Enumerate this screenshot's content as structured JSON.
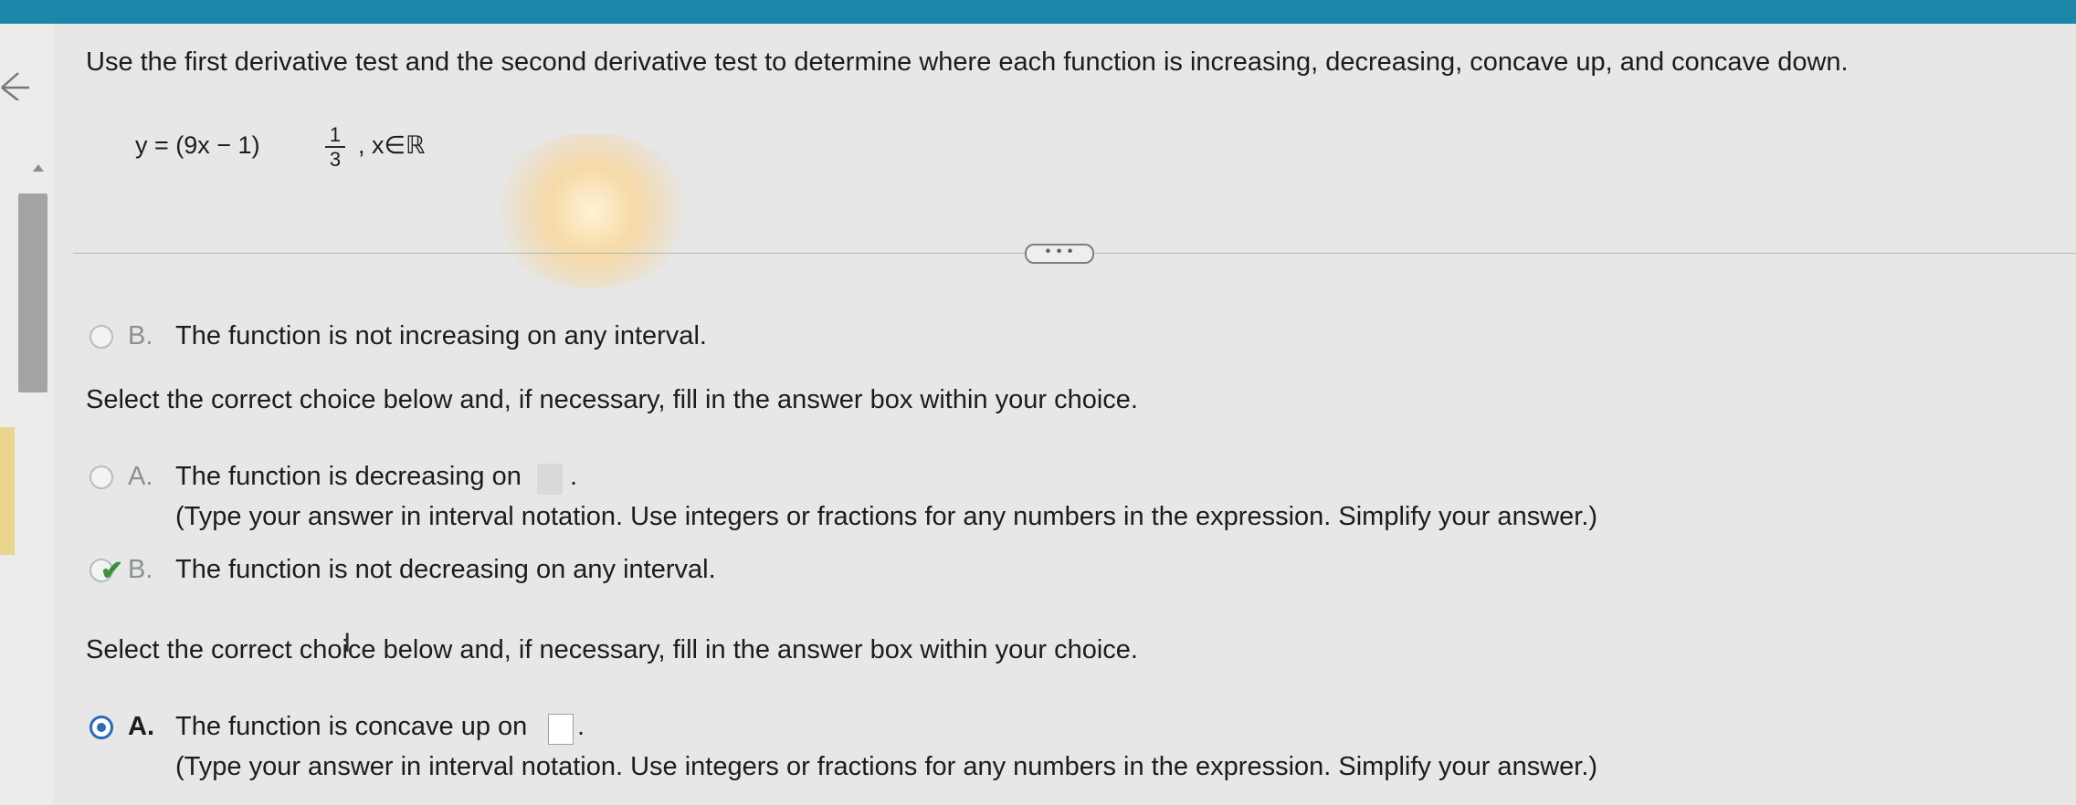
{
  "question": "Use the first derivative test and the second derivative test to determine where each function is increasing, decreasing, concave up, and concave down.",
  "formula": {
    "lhs": "y = (9x − 1)",
    "exponent_numerator": "1",
    "exponent_denominator": "3",
    "tail": ", x∈ℝ"
  },
  "more_button": "• • •",
  "increasing_section": {
    "option_b_letter": "B.",
    "option_b_text": "The function is not increasing on any interval."
  },
  "decreasing_section": {
    "prompt": "Select the correct choice below and, if necessary, fill in the answer box within your choice.",
    "option_a_letter": "A.",
    "option_a_text": "The function is decreasing on",
    "option_a_period": ".",
    "option_a_hint": "(Type your answer in interval notation. Use integers or fractions for any numbers in the expression. Simplify your answer.)",
    "option_b_letter": "B.",
    "option_b_text": "The function is not decreasing on any interval.",
    "selected": "B",
    "correct_mark": "✔"
  },
  "concave_up_section": {
    "prompt": "Select the correct choice below and, if necessary, fill in the answer box within your choice.",
    "option_a_letter": "A.",
    "option_a_text": "The function is concave up on",
    "option_a_period": ".",
    "option_a_hint": "(Type your answer in interval notation. Use integers or fractions for any numbers in the expression. Simplify your answer.)",
    "selected": "A"
  },
  "colors": {
    "topbar": "#1b86a8",
    "selected_radio": "#2b6bb3",
    "check": "#3f8f3a"
  },
  "icons": [
    "back-arrow-icon",
    "scroll-up-icon",
    "check-icon",
    "text-cursor-icon"
  ]
}
